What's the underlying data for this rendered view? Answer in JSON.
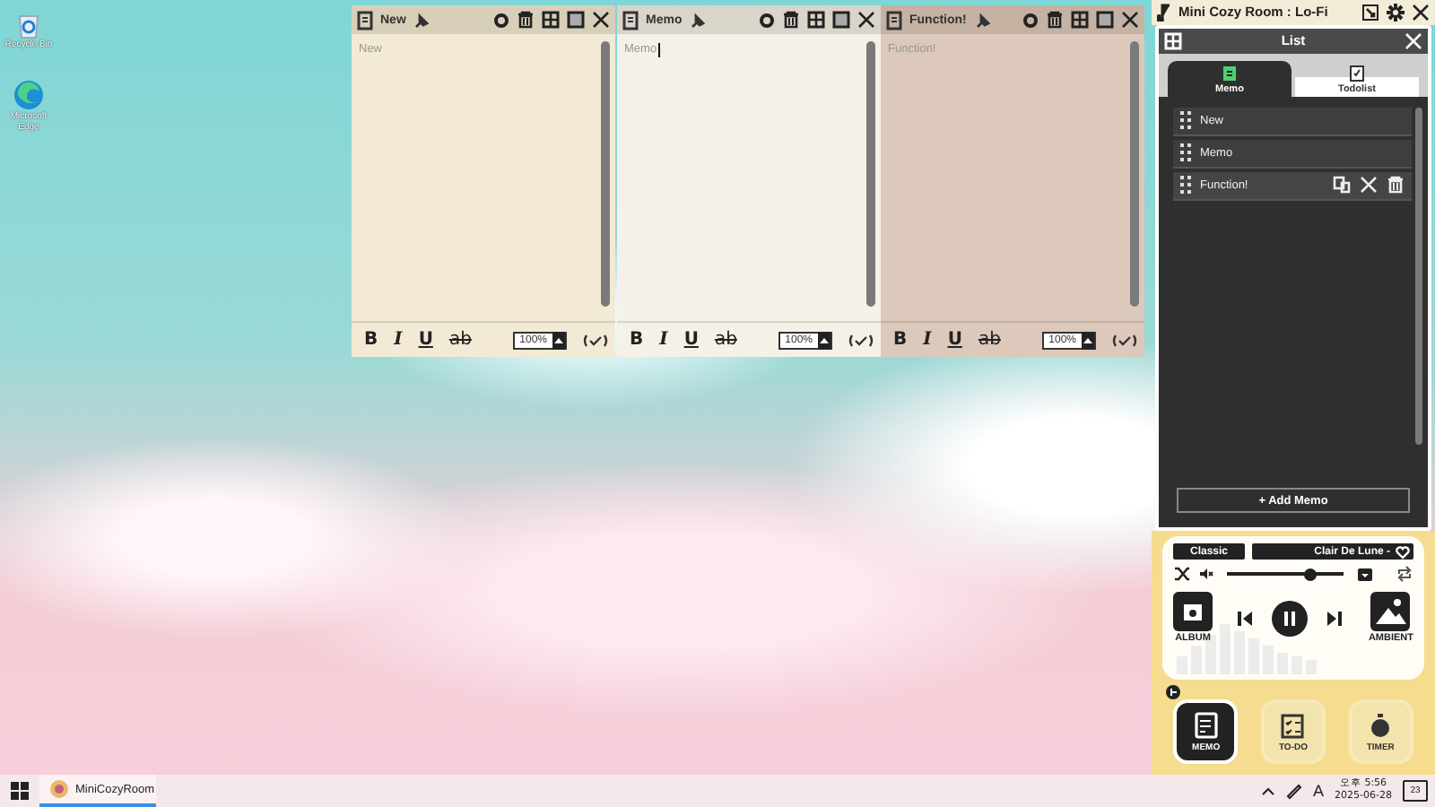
{
  "desktop_icons": [
    {
      "label": "Recycle Bin"
    },
    {
      "label": "Microsoft Edge"
    }
  ],
  "memo_windows": [
    {
      "title": "New",
      "text": "New",
      "focused": false,
      "color": "#f3ead6",
      "format_buttons": [
        "B",
        "I",
        "U",
        "ab"
      ],
      "zoom": "100%"
    },
    {
      "title": "Memo",
      "text": "Memo",
      "focused": true,
      "color": "#f5f1e8",
      "format_buttons": [
        "B",
        "I",
        "U",
        "ab"
      ],
      "zoom": "100%"
    },
    {
      "title": "Function!",
      "text": "Function!",
      "focused": false,
      "color": "#dcc9bb",
      "format_buttons": [
        "B",
        "I",
        "U",
        "ab"
      ],
      "zoom": "100%"
    }
  ],
  "app": {
    "title": "Mini Cozy Room : Lo-Fi"
  },
  "list_window": {
    "title": "List",
    "tabs": [
      {
        "label": "Memo",
        "selected": true
      },
      {
        "label": "Todolist",
        "selected": false
      }
    ],
    "items": [
      {
        "label": "New",
        "hovered": false
      },
      {
        "label": "Memo",
        "hovered": false
      },
      {
        "label": "Function!",
        "hovered": true
      }
    ],
    "add_button": "+ Add Memo"
  },
  "player": {
    "genre": "Classic",
    "track": "Clair De Lune -",
    "volume": {
      "level": 0.72
    },
    "playing": true,
    "album_label": "ALBUM",
    "ambient_label": "AMBIENT"
  },
  "nav": [
    {
      "label": "MEMO",
      "selected": true
    },
    {
      "label": "TO-DO",
      "selected": false
    },
    {
      "label": "TIMER",
      "selected": false
    }
  ],
  "taskbar": {
    "app": "MiniCozyRoom",
    "ime": "A",
    "time": "오후 5:56",
    "date": "2025-06-28",
    "notifications": "23"
  }
}
